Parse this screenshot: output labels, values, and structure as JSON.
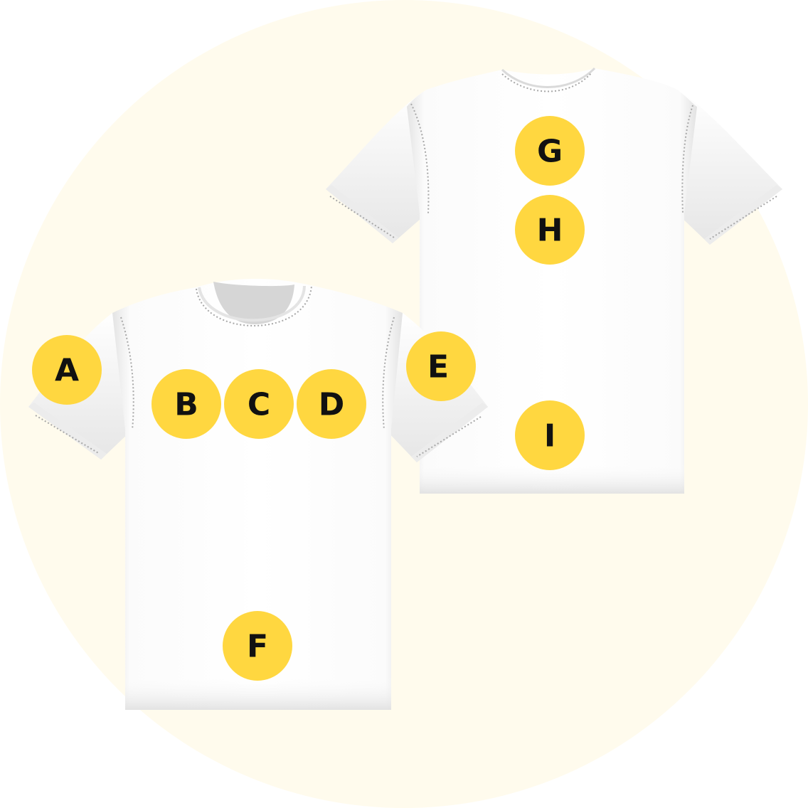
{
  "colors": {
    "background_circle": "#fffbed",
    "shirt": "#ffffff",
    "shirt_shadow": "#d9d9d9",
    "stitching": "#a8a8a8",
    "marker_fill": "#ffd740",
    "marker_text": "#111111"
  },
  "shirts": [
    {
      "name": "back-shirt",
      "view": "back"
    },
    {
      "name": "front-shirt",
      "view": "front"
    }
  ],
  "markers": [
    {
      "id": "A",
      "label": "A",
      "region": "front-right-sleeve"
    },
    {
      "id": "B",
      "label": "B",
      "region": "front-left-chest"
    },
    {
      "id": "C",
      "label": "C",
      "region": "front-center-chest"
    },
    {
      "id": "D",
      "label": "D",
      "region": "front-right-chest"
    },
    {
      "id": "E",
      "label": "E",
      "region": "front-left-sleeve"
    },
    {
      "id": "F",
      "label": "F",
      "region": "front-bottom-hem"
    },
    {
      "id": "G",
      "label": "G",
      "region": "back-upper-neck"
    },
    {
      "id": "H",
      "label": "H",
      "region": "back-upper-center"
    },
    {
      "id": "I",
      "label": "I",
      "region": "back-lower-center"
    }
  ]
}
